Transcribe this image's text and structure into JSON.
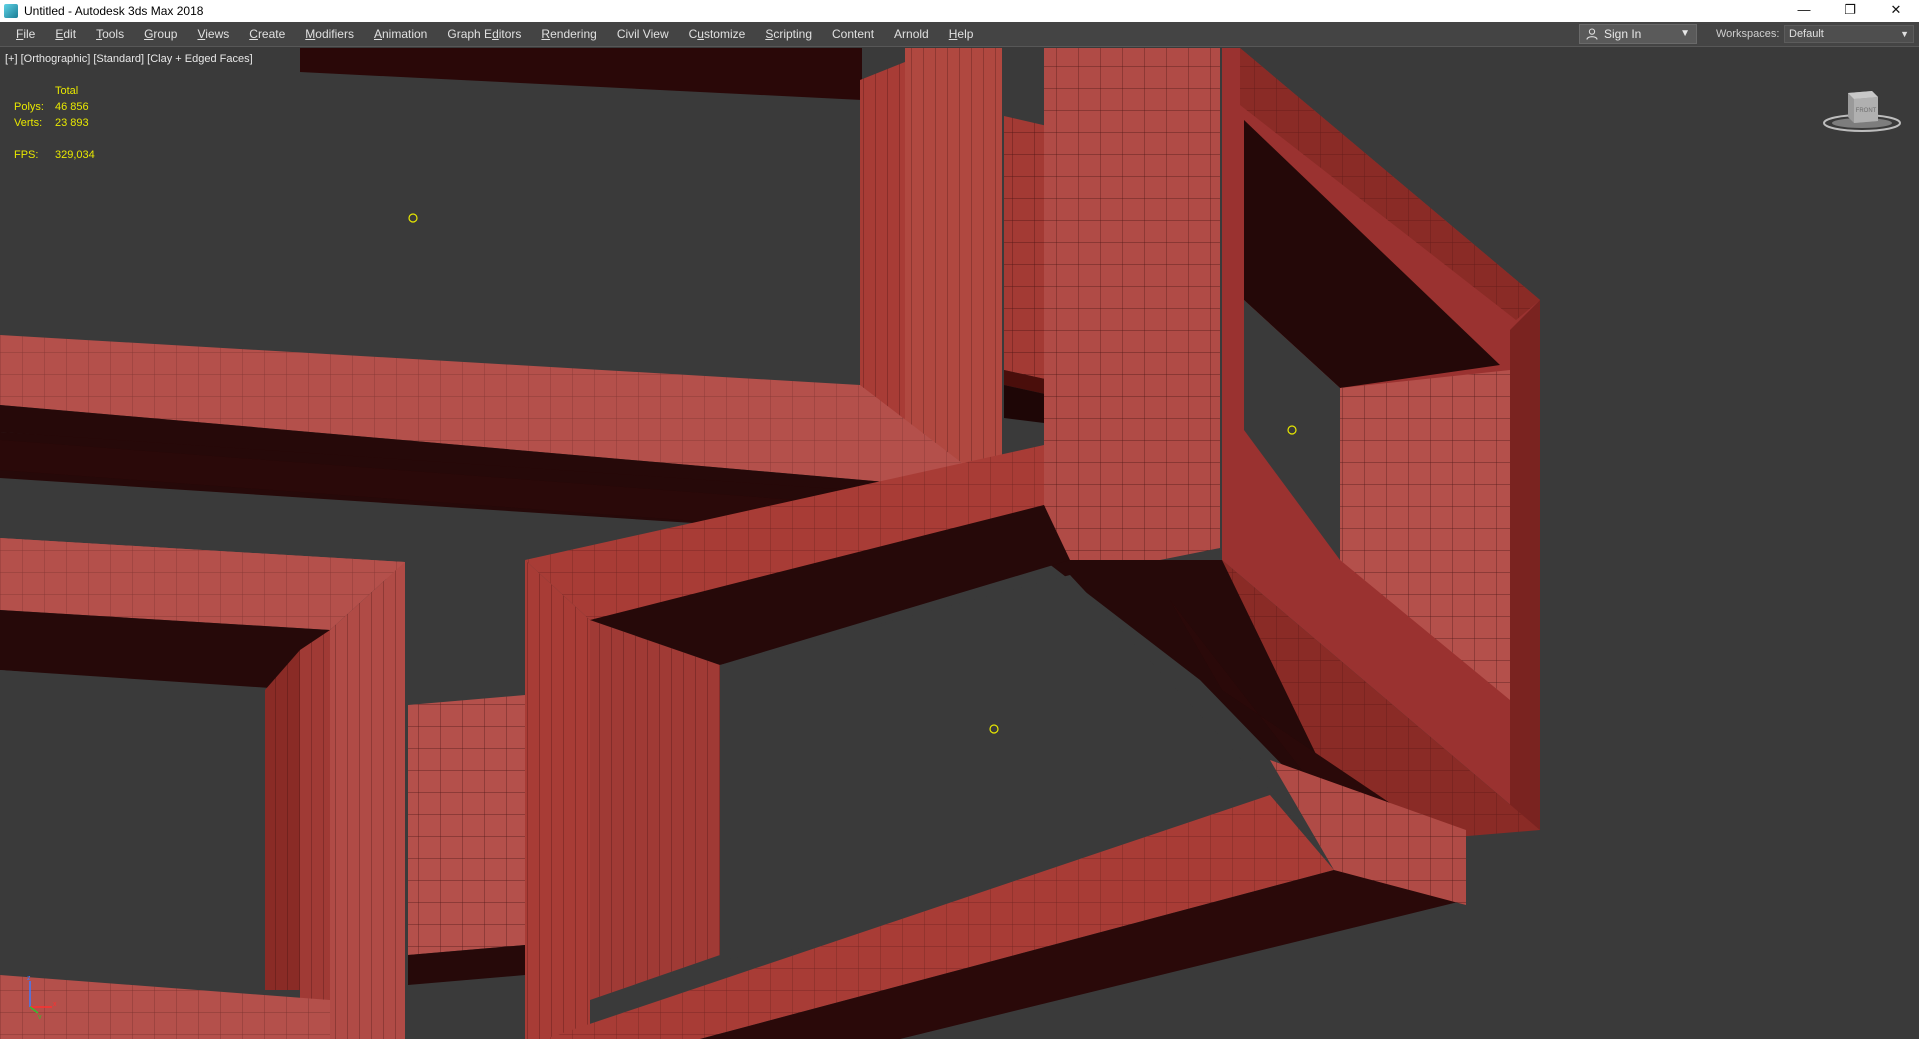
{
  "window": {
    "title": "Untitled - Autodesk 3ds Max 2018",
    "controls": {
      "minimize": "—",
      "restore": "❐",
      "close": "✕"
    }
  },
  "menu": [
    {
      "pre": "",
      "ul": "F",
      "post": "ile"
    },
    {
      "pre": "",
      "ul": "E",
      "post": "dit"
    },
    {
      "pre": "",
      "ul": "T",
      "post": "ools"
    },
    {
      "pre": "",
      "ul": "G",
      "post": "roup"
    },
    {
      "pre": "",
      "ul": "V",
      "post": "iews"
    },
    {
      "pre": "",
      "ul": "C",
      "post": "reate"
    },
    {
      "pre": "",
      "ul": "M",
      "post": "odifiers"
    },
    {
      "pre": "",
      "ul": "A",
      "post": "nimation"
    },
    {
      "pre": "Graph E",
      "ul": "d",
      "post": "itors"
    },
    {
      "pre": "",
      "ul": "R",
      "post": "endering"
    },
    {
      "pre": "Civil View",
      "ul": "",
      "post": ""
    },
    {
      "pre": "C",
      "ul": "u",
      "post": "stomize"
    },
    {
      "pre": "",
      "ul": "S",
      "post": "cripting"
    },
    {
      "pre": "Content",
      "ul": "",
      "post": ""
    },
    {
      "pre": "Arnold",
      "ul": "",
      "post": ""
    },
    {
      "pre": "",
      "ul": "H",
      "post": "elp"
    }
  ],
  "signin": {
    "label": "Sign In",
    "icon": "user-icon"
  },
  "workspaces": {
    "label": "Workspaces:",
    "value": "Default"
  },
  "viewport": {
    "label": "[+] [Orthographic] [Standard] [Clay + Edged Faces]",
    "stats": {
      "header": "Total",
      "rows": [
        {
          "key": "Polys:",
          "value": "46 856"
        },
        {
          "key": "Verts:",
          "value": "23 893"
        }
      ],
      "fps_key": "FPS:",
      "fps_value": "329,034"
    },
    "viewcube_label": "FRONT",
    "axis": {
      "x": "x",
      "y": "y",
      "z": "z"
    }
  },
  "colors": {
    "viewport_bg": "#3a3a3a",
    "mesh_light": "#b4504b",
    "mesh_mid": "#a03a35",
    "mesh_dark": "#6a1611",
    "mesh_shadow": "#260909",
    "stats_text": "#e8e800"
  }
}
